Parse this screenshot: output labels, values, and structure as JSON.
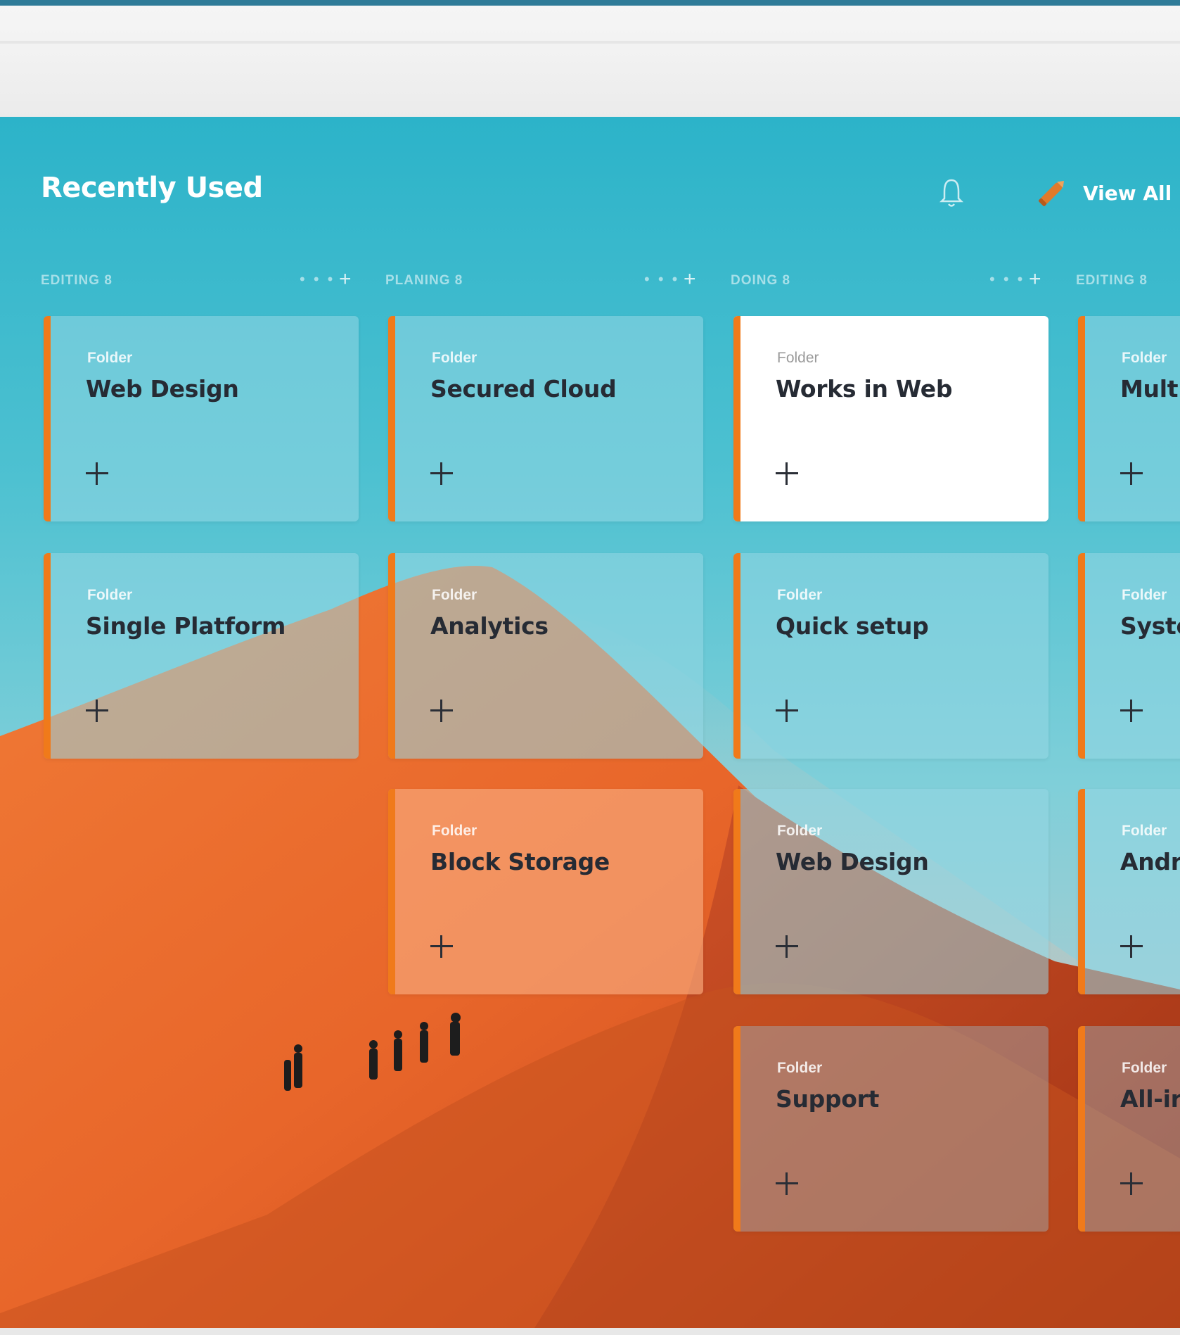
{
  "header": {
    "title": "Recently Used",
    "view_all_label": "View All"
  },
  "colors": {
    "accent": "#f07a1a",
    "sky": "#2cb3c9",
    "dune": "#e8742e",
    "text_dark": "#262b34"
  },
  "icons": {
    "bell": "bell-icon",
    "pencil": "pencil-icon",
    "add": "plus-icon",
    "more": "more-dots-icon"
  },
  "columns": [
    {
      "name": "EDITING 8",
      "cards": [
        {
          "kind": "Folder",
          "title": "Web Design",
          "style": "teal"
        },
        {
          "kind": "Folder",
          "title": "Single Platform",
          "style": "teal"
        }
      ]
    },
    {
      "name": "PLANING 8",
      "cards": [
        {
          "kind": "Folder",
          "title": "Secured Cloud",
          "style": "teal"
        },
        {
          "kind": "Folder",
          "title": "Analytics",
          "style": "teal"
        },
        {
          "kind": "Folder",
          "title": "Block Storage",
          "style": "peach"
        }
      ]
    },
    {
      "name": "DOING 8",
      "cards": [
        {
          "kind": "Folder",
          "title": "Works in Web",
          "style": "white"
        },
        {
          "kind": "Folder",
          "title": "Quick setup",
          "style": "teal"
        },
        {
          "kind": "Folder",
          "title": "Web Design",
          "style": "teal"
        },
        {
          "kind": "Folder",
          "title": "Support",
          "style": "dim"
        }
      ]
    },
    {
      "name": "EDITING 8",
      "cards": [
        {
          "kind": "Folder",
          "title": "Multi",
          "style": "teal"
        },
        {
          "kind": "Folder",
          "title": "Syste",
          "style": "teal"
        },
        {
          "kind": "Folder",
          "title": "Andr",
          "style": "teal"
        },
        {
          "kind": "Folder",
          "title": "All-ir",
          "style": "dim"
        }
      ]
    }
  ],
  "column_controls": {
    "more": "• • •",
    "add": "+"
  }
}
